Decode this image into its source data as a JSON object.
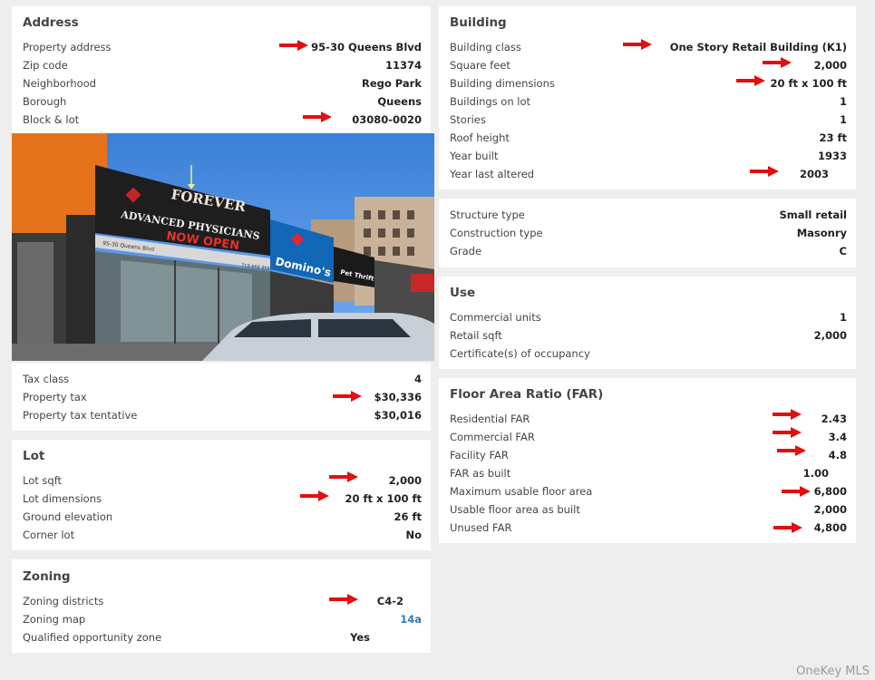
{
  "address": {
    "title": "Address",
    "rows": [
      {
        "label": "Property address",
        "value": "95-30 Queens Blvd"
      },
      {
        "label": "Zip code",
        "value": "11374"
      },
      {
        "label": "Neighborhood",
        "value": "Rego Park"
      },
      {
        "label": "Borough",
        "value": "Queens"
      },
      {
        "label": "Block & lot",
        "value": "03080-0020"
      }
    ]
  },
  "photo": {
    "sign_forever": "FOREVER",
    "sign_advanced": "ADVANCED PHYSICIANS",
    "sign_now_open": "NOW OPEN",
    "sign_address": "95-30 Queens Blvd",
    "sign_dominos": "Domino's",
    "sign_phone": "718 868 8684",
    "sign_pet": "Pet Thrift"
  },
  "tax": {
    "rows": [
      {
        "label": "Tax class",
        "value": "4"
      },
      {
        "label": "Property tax",
        "value": "$30,336"
      },
      {
        "label": "Property tax tentative",
        "value": "$30,016"
      }
    ]
  },
  "lot": {
    "title": "Lot",
    "rows": [
      {
        "label": "Lot sqft",
        "value": "2,000"
      },
      {
        "label": "Lot dimensions",
        "value": "20 ft x 100 ft"
      },
      {
        "label": "Ground elevation",
        "value": "26 ft"
      },
      {
        "label": "Corner lot",
        "value": "No"
      }
    ]
  },
  "zoning": {
    "title": "Zoning",
    "rows": [
      {
        "label": "Zoning districts",
        "value": "C4-2"
      },
      {
        "label": "Zoning map",
        "value": "14a"
      },
      {
        "label": "Qualified opportunity zone",
        "value": "Yes"
      }
    ]
  },
  "building": {
    "title": "Building",
    "rows": [
      {
        "label": "Building class",
        "value": "One Story Retail Building (K1)"
      },
      {
        "label": "Square feet",
        "value": "2,000"
      },
      {
        "label": "Building dimensions",
        "value": "20 ft x 100 ft"
      },
      {
        "label": "Buildings on lot",
        "value": "1"
      },
      {
        "label": "Stories",
        "value": "1"
      },
      {
        "label": "Roof height",
        "value": "23 ft"
      },
      {
        "label": "Year built",
        "value": "1933"
      },
      {
        "label": "Year last altered",
        "value": "2003"
      }
    ]
  },
  "structure": {
    "rows": [
      {
        "label": "Structure type",
        "value": "Small retail"
      },
      {
        "label": "Construction type",
        "value": "Masonry"
      },
      {
        "label": "Grade",
        "value": "C"
      }
    ]
  },
  "use": {
    "title": "Use",
    "rows": [
      {
        "label": "Commercial units",
        "value": "1"
      },
      {
        "label": "Retail sqft",
        "value": "2,000"
      },
      {
        "label": "Certificate(s) of occupancy",
        "value": ""
      }
    ]
  },
  "far": {
    "title": "Floor Area Ratio (FAR)",
    "rows": [
      {
        "label": "Residential FAR",
        "value": "2.43"
      },
      {
        "label": "Commercial FAR",
        "value": "3.4"
      },
      {
        "label": "Facility FAR",
        "value": "4.8"
      },
      {
        "label": "FAR as built",
        "value": "1.00"
      },
      {
        "label": "Maximum usable floor area",
        "value": "6,800"
      },
      {
        "label": "Usable floor area as built",
        "value": "2,000"
      },
      {
        "label": "Unused FAR",
        "value": "4,800"
      }
    ]
  },
  "watermark": "OneKey MLS",
  "colors": {
    "arrow": "#e01010",
    "link": "#2a7bbf",
    "card": "#ffffff",
    "page": "#eeeeee"
  }
}
